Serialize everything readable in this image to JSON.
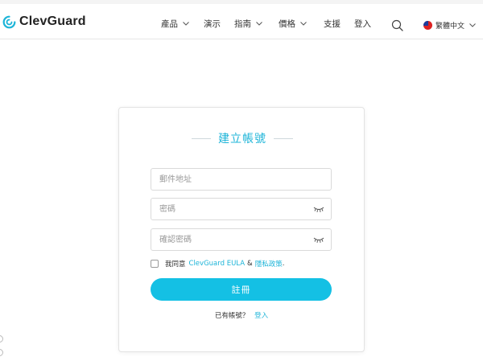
{
  "brand": {
    "logo_text": "ClevGuard",
    "color": "#1cb4d8"
  },
  "nav": {
    "items": [
      {
        "label": "產品",
        "has_dropdown": true
      },
      {
        "label": "演示",
        "has_dropdown": false
      },
      {
        "label": "指南",
        "has_dropdown": true
      },
      {
        "label": "價格",
        "has_dropdown": true
      },
      {
        "label": "支援",
        "has_dropdown": false
      },
      {
        "label": "登入",
        "has_dropdown": false
      }
    ],
    "search_icon": "search-icon",
    "language": {
      "label": "繁體中文",
      "icon": "taiwan-flag-icon",
      "has_dropdown": true
    }
  },
  "form": {
    "title": "建立帳號",
    "email": {
      "placeholder": "郵件地址",
      "value": ""
    },
    "password": {
      "placeholder": "密碼",
      "value": "",
      "icon": "eye-closed-icon"
    },
    "confirm_password": {
      "placeholder": "確認密碼",
      "value": "",
      "icon": "eye-closed-icon"
    },
    "agreement": {
      "checked": false,
      "prefix": "我同意",
      "eula_link": "ClevGuard EULA",
      "separator": "&",
      "privacy_link": "隱私政策",
      "suffix": "."
    },
    "submit_label": "註冊",
    "login_prompt": "已有帳號？",
    "login_link": "登入"
  },
  "colors": {
    "accent": "#1cb4d8",
    "button": "#14c0e4",
    "border": "#dadada"
  }
}
